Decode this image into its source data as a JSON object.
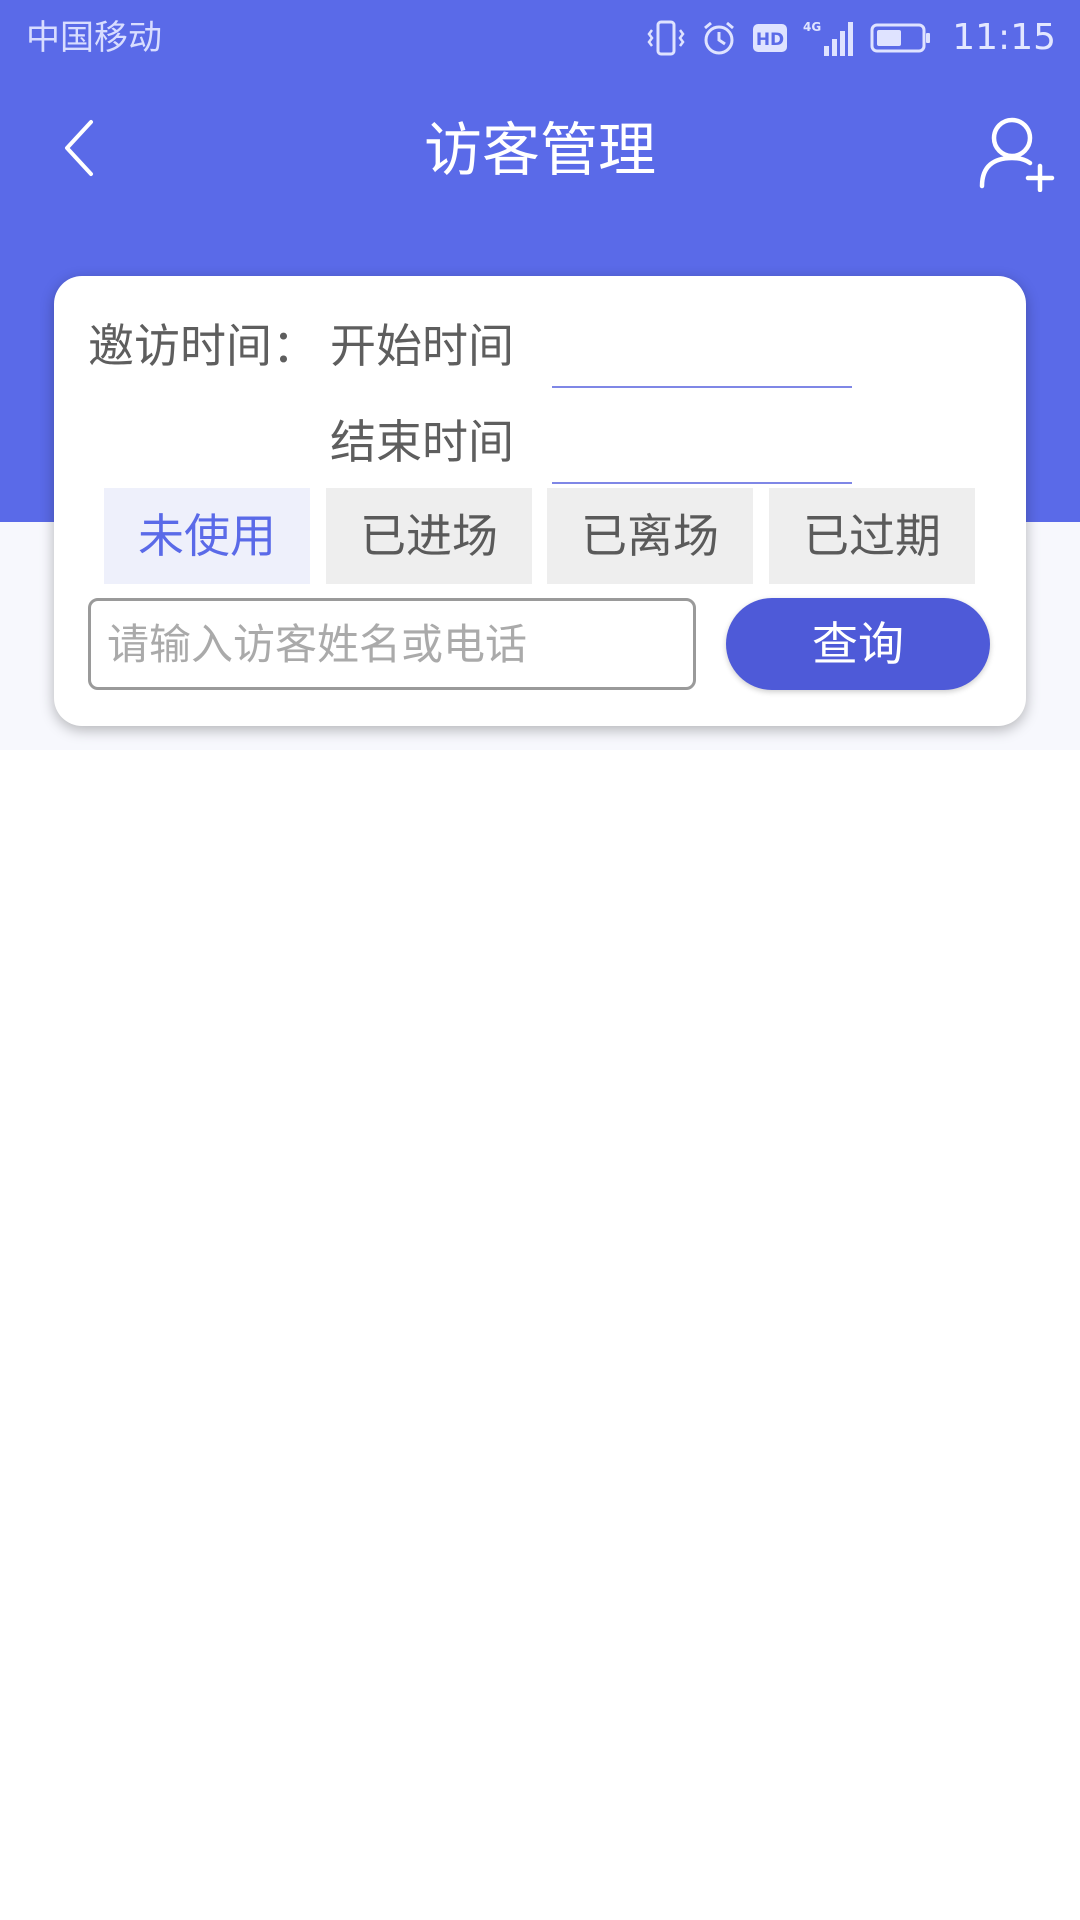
{
  "status_bar": {
    "carrier": "中国移动",
    "time": "11:15",
    "hd_badge": "HD",
    "network_badge": "4G",
    "icons": [
      "vibrate-icon",
      "alarm-icon",
      "hd-icon",
      "signal-4g-icon",
      "battery-icon"
    ]
  },
  "header": {
    "title": "访客管理",
    "back_icon": "chevron-left-icon",
    "add_visitor_icon": "add-user-icon"
  },
  "filter": {
    "time_label": "邀访时间：",
    "start_label": "开始时间",
    "start_value": "",
    "end_label": "结束时间",
    "end_value": "",
    "tabs": [
      {
        "label": "未使用",
        "active": true
      },
      {
        "label": "已进场",
        "active": false
      },
      {
        "label": "已离场",
        "active": false
      },
      {
        "label": "已过期",
        "active": false
      }
    ],
    "search": {
      "value": "",
      "placeholder": "请输入访客姓名或电话"
    },
    "query_label": "查询"
  },
  "colors": {
    "primary": "#5a6ae8",
    "button": "#4e5ad8",
    "tab_inactive_bg": "#eeeeee",
    "tab_active_bg": "#eef0fb"
  }
}
